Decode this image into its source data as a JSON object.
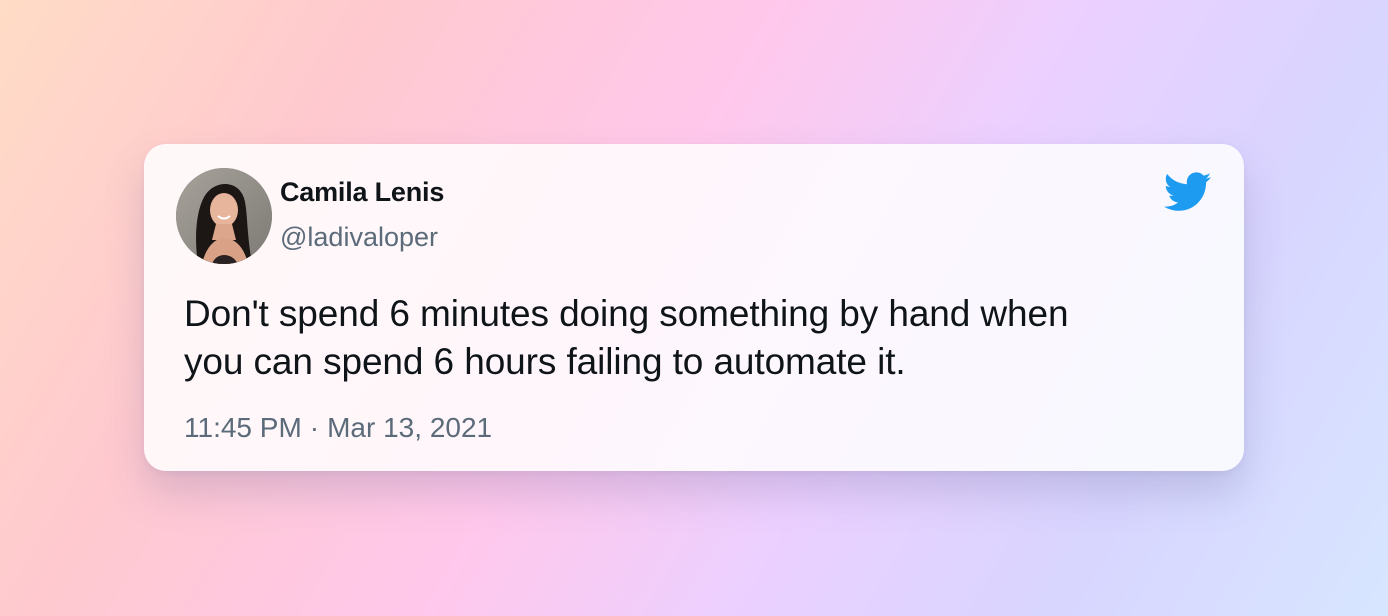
{
  "tweet": {
    "author_name": "Camila Lenis",
    "author_handle": "@ladivaloper",
    "text_line_1": "Don't spend 6 minutes doing something by hand when",
    "text_line_2": "you can spend 6 hours failing to automate it.",
    "time": "11:45 PM",
    "separator": "·",
    "date": "Mar 13, 2021"
  },
  "icons": {
    "brand": "twitter-bird-icon",
    "avatar": "profile-photo"
  },
  "colors": {
    "twitter_blue": "#1d9bf0",
    "primary_text": "#0f1419",
    "secondary_text": "#5b6b7a"
  }
}
